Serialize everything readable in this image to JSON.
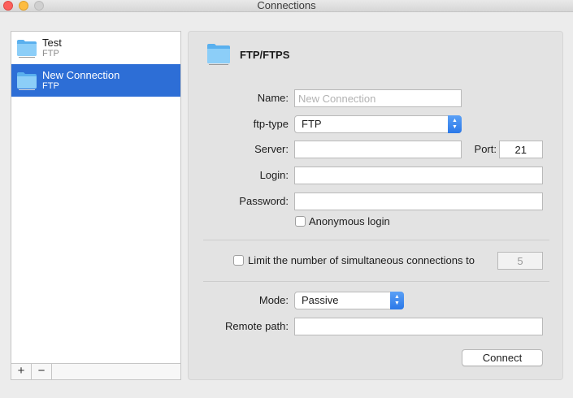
{
  "window": {
    "title": "Connections"
  },
  "sidebar": {
    "items": [
      {
        "name": "Test",
        "type": "FTP",
        "selected": false
      },
      {
        "name": "New Connection",
        "type": "FTP",
        "selected": true
      }
    ],
    "add_label": "+",
    "remove_label": "−"
  },
  "panel": {
    "title": "FTP/FTPS",
    "name_label": "Name:",
    "name_placeholder": "New Connection",
    "name_value": "",
    "ftp_type_label": "ftp-type",
    "ftp_type_value": "FTP",
    "server_label": "Server:",
    "server_value": "",
    "port_label": "Port:",
    "port_value": "21",
    "login_label": "Login:",
    "login_value": "",
    "password_label": "Password:",
    "password_value": "",
    "anonymous_label": "Anonymous login",
    "limit_label": "Limit the number of simultaneous connections to",
    "limit_value": "5",
    "mode_label": "Mode:",
    "mode_value": "Passive",
    "remote_path_label": "Remote path:",
    "remote_path_value": "",
    "connect_label": "Connect"
  },
  "colors": {
    "selection": "#2d6ed6",
    "popup_arrows": "#2b78e8"
  }
}
